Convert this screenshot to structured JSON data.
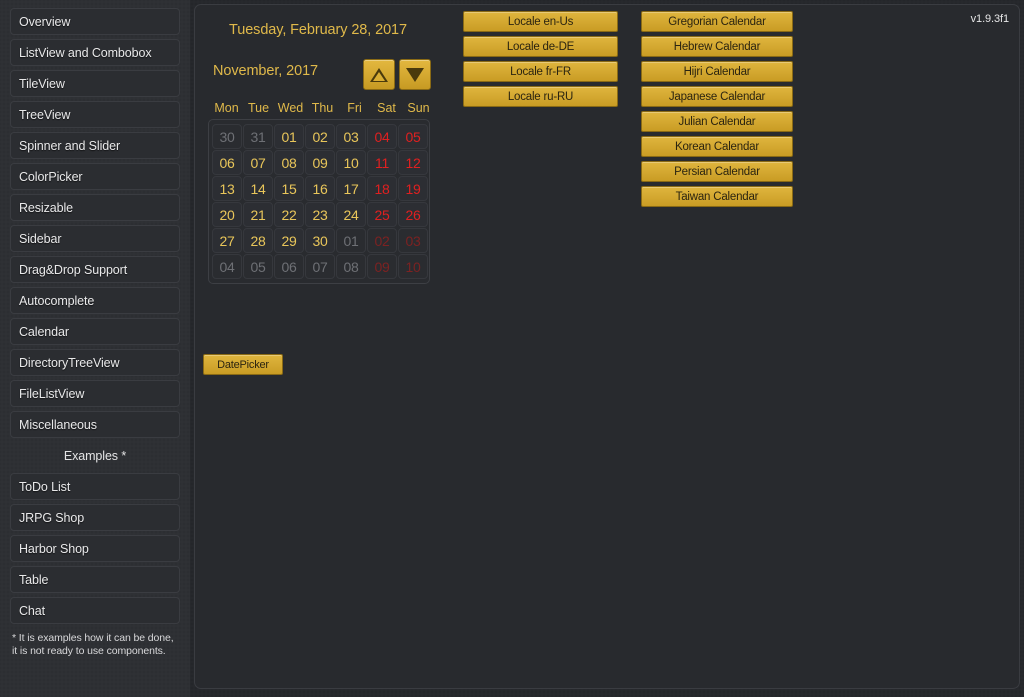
{
  "app": {
    "version_label": "v1.9.3f1"
  },
  "sidebar": {
    "items": [
      {
        "label": "Overview"
      },
      {
        "label": "ListView and Combobox"
      },
      {
        "label": "TileView"
      },
      {
        "label": "TreeView"
      },
      {
        "label": "Spinner and Slider"
      },
      {
        "label": "ColorPicker"
      },
      {
        "label": "Resizable"
      },
      {
        "label": "Sidebar"
      },
      {
        "label": "Drag&Drop Support"
      },
      {
        "label": "Autocomplete"
      },
      {
        "label": "Calendar"
      },
      {
        "label": "DirectoryTreeView"
      },
      {
        "label": "FileListView"
      },
      {
        "label": "Miscellaneous"
      }
    ],
    "examples_header": "Examples *",
    "examples": [
      {
        "label": "ToDo List"
      },
      {
        "label": "JRPG Shop"
      },
      {
        "label": "Harbor Shop"
      },
      {
        "label": "Table"
      },
      {
        "label": "Chat"
      }
    ],
    "footnote": "* It is examples how it can be done, it is not ready to use components."
  },
  "calendar": {
    "today_label": "Tuesday, February 28, 2017",
    "month_label": "November, 2017",
    "prev_icon": "triangle-up-icon",
    "next_icon": "triangle-down-icon",
    "weekday_headers": [
      "Mon",
      "Tue",
      "Wed",
      "Thu",
      "Fri",
      "Sat",
      "Sun"
    ],
    "days": [
      {
        "label": "30",
        "state": "out"
      },
      {
        "label": "31",
        "state": "out"
      },
      {
        "label": "01",
        "state": "cur"
      },
      {
        "label": "02",
        "state": "cur"
      },
      {
        "label": "03",
        "state": "cur"
      },
      {
        "label": "04",
        "state": "cur-weekend"
      },
      {
        "label": "05",
        "state": "cur-weekend"
      },
      {
        "label": "06",
        "state": "cur"
      },
      {
        "label": "07",
        "state": "cur"
      },
      {
        "label": "08",
        "state": "cur"
      },
      {
        "label": "09",
        "state": "cur"
      },
      {
        "label": "10",
        "state": "cur"
      },
      {
        "label": "11",
        "state": "cur-weekend"
      },
      {
        "label": "12",
        "state": "cur-weekend"
      },
      {
        "label": "13",
        "state": "cur"
      },
      {
        "label": "14",
        "state": "cur"
      },
      {
        "label": "15",
        "state": "cur"
      },
      {
        "label": "16",
        "state": "cur"
      },
      {
        "label": "17",
        "state": "cur"
      },
      {
        "label": "18",
        "state": "cur-weekend"
      },
      {
        "label": "19",
        "state": "cur-weekend"
      },
      {
        "label": "20",
        "state": "cur"
      },
      {
        "label": "21",
        "state": "cur"
      },
      {
        "label": "22",
        "state": "cur"
      },
      {
        "label": "23",
        "state": "cur"
      },
      {
        "label": "24",
        "state": "cur"
      },
      {
        "label": "25",
        "state": "cur-weekend"
      },
      {
        "label": "26",
        "state": "cur-weekend"
      },
      {
        "label": "27",
        "state": "cur"
      },
      {
        "label": "28",
        "state": "cur"
      },
      {
        "label": "29",
        "state": "cur"
      },
      {
        "label": "30",
        "state": "cur"
      },
      {
        "label": "01",
        "state": "out"
      },
      {
        "label": "02",
        "state": "out-weekend"
      },
      {
        "label": "03",
        "state": "out-weekend"
      },
      {
        "label": "04",
        "state": "out"
      },
      {
        "label": "05",
        "state": "out"
      },
      {
        "label": "06",
        "state": "out"
      },
      {
        "label": "07",
        "state": "out"
      },
      {
        "label": "08",
        "state": "out"
      },
      {
        "label": "09",
        "state": "out-weekend"
      },
      {
        "label": "10",
        "state": "out-weekend"
      }
    ],
    "datepicker_button": "DatePicker"
  },
  "locale_buttons": [
    {
      "label": "Locale en-Us"
    },
    {
      "label": "Locale de-DE"
    },
    {
      "label": "Locale fr-FR"
    },
    {
      "label": "Locale ru-RU"
    }
  ],
  "calendar_system_buttons": [
    {
      "label": "Gregorian Calendar"
    },
    {
      "label": "Hebrew Calendar"
    },
    {
      "label": "Hijri Calendar"
    },
    {
      "label": "Japanese Calendar"
    },
    {
      "label": "Julian Calendar"
    },
    {
      "label": "Korean Calendar"
    },
    {
      "label": "Persian Calendar"
    },
    {
      "label": "Taiwan Calendar"
    }
  ],
  "colors": {
    "gold": "#d4a82c",
    "gold_text": "#e0b94a",
    "weekend_red": "#e02020",
    "panel_bg": "#282a2e",
    "sidebar_bg": "#2e3034"
  }
}
